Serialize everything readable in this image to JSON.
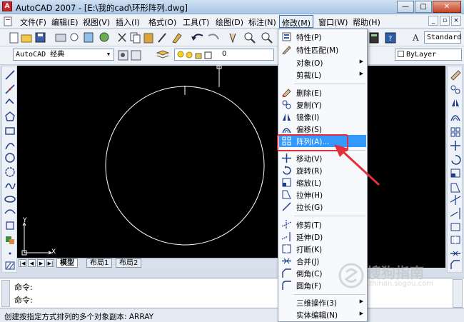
{
  "window": {
    "title": "AutoCAD 2007 - [E:\\我的cad\\环形阵列.dwg]",
    "buttons": {
      "minimize": "—",
      "maximize": "□",
      "close": "✕"
    }
  },
  "menubar": {
    "items": [
      {
        "label": "文件(F)"
      },
      {
        "label": "编辑(E)"
      },
      {
        "label": "视图(V)"
      },
      {
        "label": "插入(I)"
      },
      {
        "label": "格式(O)"
      },
      {
        "label": "工具(T)"
      },
      {
        "label": "绘图(D)"
      },
      {
        "label": "标注(N)"
      },
      {
        "label": "修改(M)",
        "active": true
      },
      {
        "label": "窗口(W)"
      },
      {
        "label": "帮助(H)"
      }
    ]
  },
  "toolbar": {
    "workspace": "AutoCAD 经典",
    "layer_value": "0",
    "text_style": "Standard",
    "linetype": "ByLayer"
  },
  "modify_menu": {
    "items": [
      {
        "label": "特性(P)",
        "icon": "properties-icon"
      },
      {
        "label": "特性匹配(M)",
        "icon": "match-properties-icon"
      },
      {
        "label": "对象(O)",
        "submenu": true
      },
      {
        "label": "剪裁(L)",
        "submenu": true
      },
      {
        "label": "删除(E)",
        "icon": "erase-icon"
      },
      {
        "label": "复制(Y)",
        "icon": "copy-icon"
      },
      {
        "label": "镜像(I)",
        "icon": "mirror-icon"
      },
      {
        "label": "偏移(S)",
        "icon": "offset-icon"
      },
      {
        "label": "阵列(A)...",
        "icon": "array-icon",
        "highlighted": true
      },
      {
        "label": "移动(V)",
        "icon": "move-icon"
      },
      {
        "label": "旋转(R)",
        "icon": "rotate-icon"
      },
      {
        "label": "缩放(L)",
        "icon": "scale-icon"
      },
      {
        "label": "拉伸(H)",
        "icon": "stretch-icon"
      },
      {
        "label": "拉长(G)",
        "icon": "lengthen-icon"
      },
      {
        "label": "修剪(T)",
        "icon": "trim-icon"
      },
      {
        "label": "延伸(D)",
        "icon": "extend-icon"
      },
      {
        "label": "打断(K)",
        "icon": "break-icon"
      },
      {
        "label": "合并(J)",
        "icon": "join-icon"
      },
      {
        "label": "倒角(C)",
        "icon": "chamfer-icon"
      },
      {
        "label": "圆角(F)",
        "icon": "fillet-icon"
      },
      {
        "label": "三维操作(3)",
        "submenu": true
      },
      {
        "label": "实体编辑(N)",
        "submenu": true
      }
    ]
  },
  "canvas": {
    "ucs_x": "X",
    "ucs_y": "Y"
  },
  "layout_tabs": [
    "模型",
    "布局1",
    "布局2"
  ],
  "command": {
    "line1": "命令:",
    "line2": "命令:"
  },
  "status": {
    "text": "创建按指定方式排列的多个对象副本:   ARRAY"
  },
  "watermark": {
    "text": "搜狗指南",
    "url": "zhinan.sogou.com"
  },
  "colors": {
    "highlight": "#3399ff",
    "annotation": "#e2303a",
    "canvas": "#000000"
  }
}
